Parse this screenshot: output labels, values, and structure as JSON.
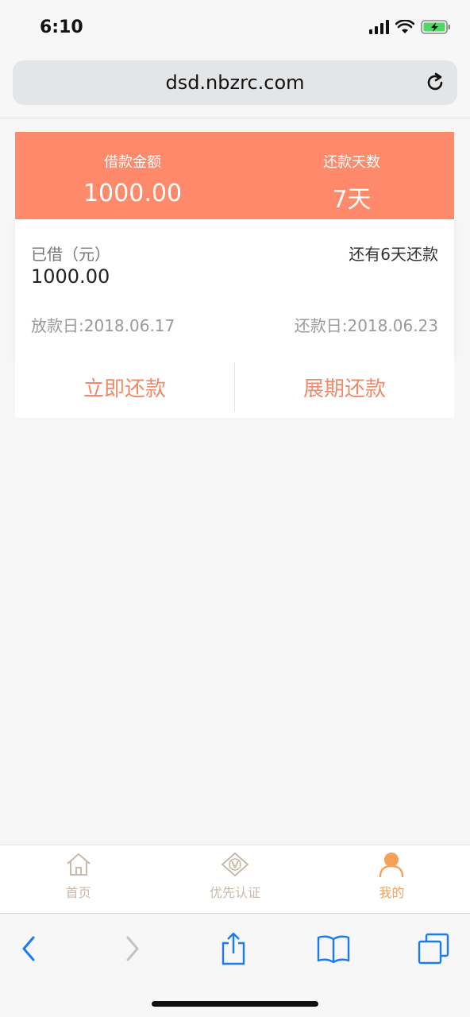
{
  "status_bar": {
    "time": "6:10"
  },
  "browser": {
    "url": "dsd.nbzrc.com"
  },
  "loan": {
    "amount_label": "借款金额",
    "amount_value": "1000.00",
    "days_label": "还款天数",
    "days_value": "7天",
    "borrowed_label": "已借（元）",
    "borrowed_amount": "1000.00",
    "remaining_text": "还有6天还款",
    "loan_date": "放款日:2018.06.17",
    "repay_date": "还款日:2018.06.23"
  },
  "actions": {
    "repay_now": "立即还款",
    "extend_repay": "展期还款"
  },
  "tabs": [
    {
      "label": "首页",
      "icon": "home-icon"
    },
    {
      "label": "优先认证",
      "icon": "vip-icon"
    },
    {
      "label": "我的",
      "icon": "user-icon"
    }
  ],
  "colors": {
    "header_bg": "#ff8a6b",
    "action_text": "#f08a6a",
    "active_tab": "#f5a155",
    "safari_blue": "#1a7cf0"
  }
}
